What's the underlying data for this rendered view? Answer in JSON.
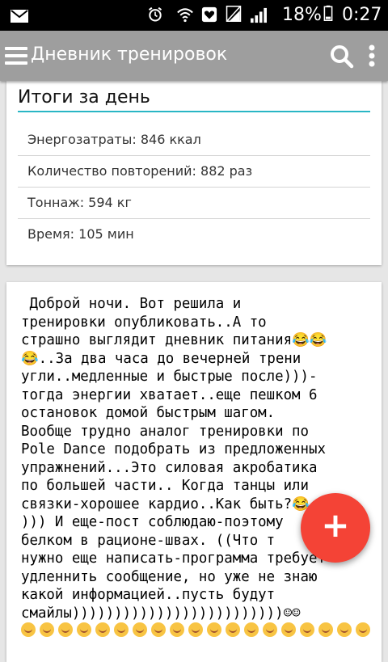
{
  "status_bar": {
    "battery_percent": "18%",
    "time": "0:27",
    "icons": [
      "mail-icon",
      "alarm-icon",
      "wifi-icon",
      "heart-icon",
      "sim-off-icon",
      "signal-icon",
      "battery-icon"
    ]
  },
  "app_bar": {
    "title": "Дневник тренировок",
    "icons": [
      "menu-icon",
      "search-icon",
      "overflow-menu-icon"
    ]
  },
  "summary": {
    "title": "Итоги за день",
    "items": [
      "Энергозатраты: 846 ккал",
      "Количество повторений: 882 раз",
      "Тоннаж: 594 кг",
      "Время: 105 мин"
    ]
  },
  "post": {
    "lines": [
      " Доброй ночи. Вот решила и",
      "тренировки опубликовать..А то",
      "страшно выглядит дневник питания😂😂",
      "😂..За два часа до вечерней трени",
      "угли..медленные и быстрые после)))-",
      "тогда энергии хватает..еще пешком 6",
      "остановок домой быстрым шагом.",
      "Вообще трудно аналог тренировки по",
      "Pole Dance подобрать из предложенных",
      "упражнений...Это силовая акробатика",
      "по большей части.. Когда танцы или",
      "связки-хорошее кардио..Как быть?😂",
      "))) И еще-пост соблюдаю-поэтому",
      "белком в рационе-швах. ((Что т",
      "нужно еще написать-программа требует",
      "удленнить сообщение, но уже не знаю",
      "какой информацией..пусть будут",
      "смайлы)))))))))))))))))))))))))☺☺"
    ],
    "trailing_smiley_count": 19
  },
  "fab": {
    "label": "+"
  },
  "colors": {
    "app_bar": "#9e9e9e",
    "accent_underline": "#29b6c5",
    "fab": "#f44336",
    "status_bar": "#000000"
  }
}
